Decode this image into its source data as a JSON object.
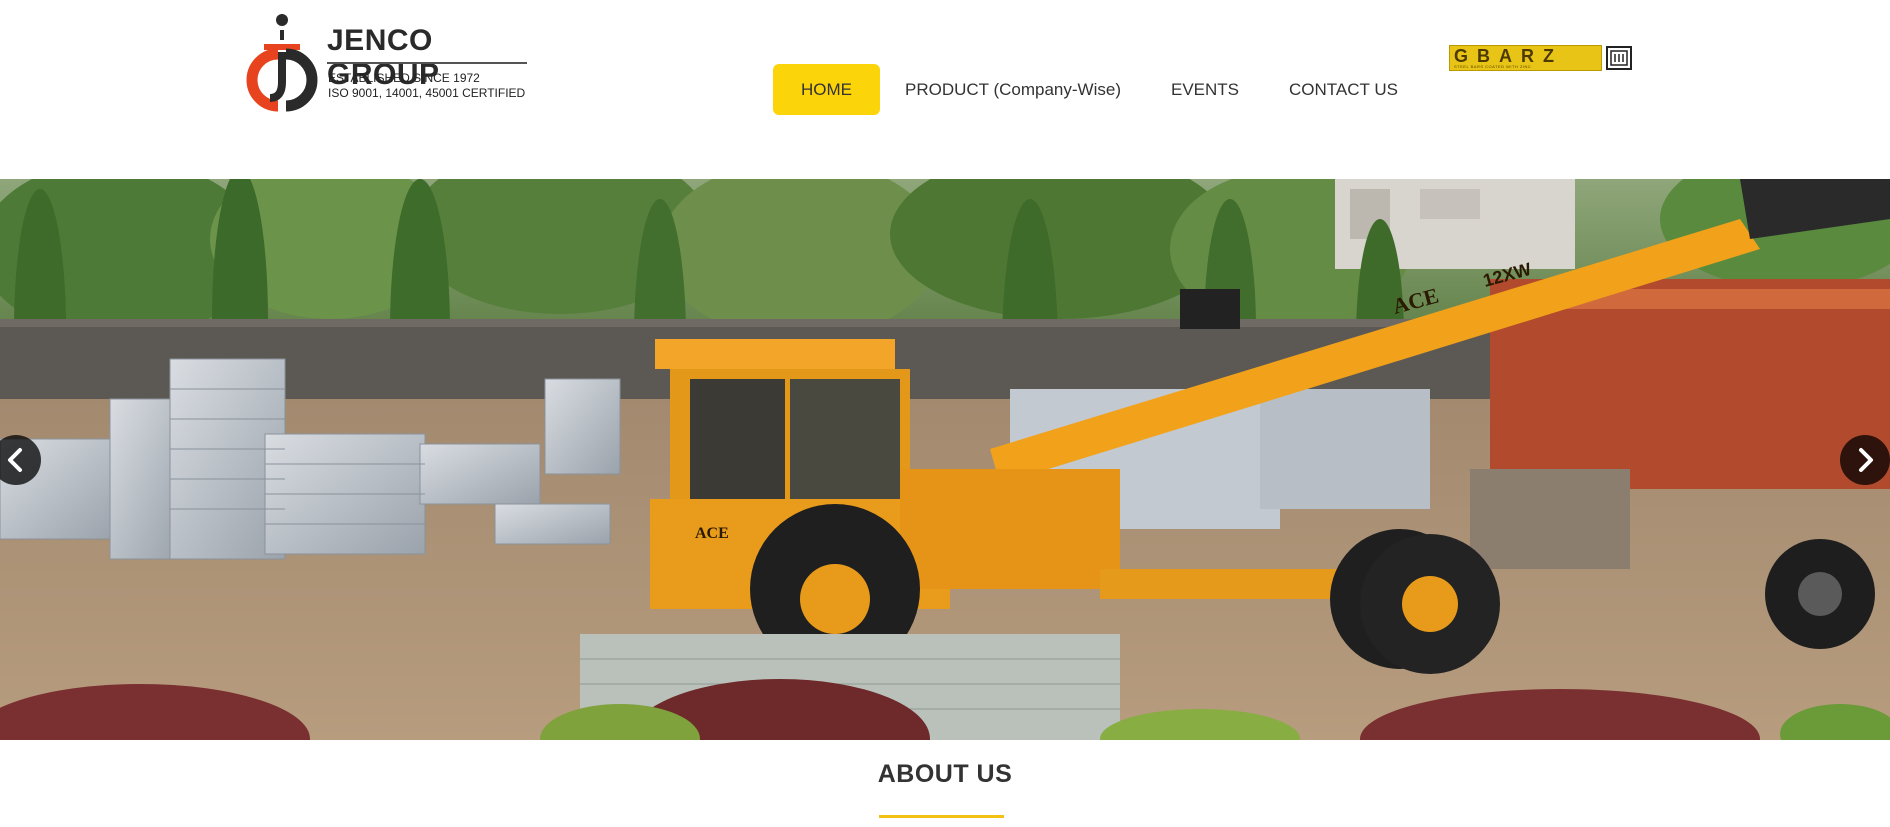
{
  "brand": {
    "name": "JENCO GROUP",
    "tagline": "ESTABLISHED SINCE 1972",
    "certification": "ISO 9001, 14001, 45001 CERTIFIED",
    "colors": {
      "orange": "#e8431f",
      "dark": "#2a2a2a"
    }
  },
  "nav": {
    "items": [
      {
        "label": "HOME",
        "active": true
      },
      {
        "label": "PRODUCT (Company-Wise)",
        "active": false
      },
      {
        "label": "EVENTS",
        "active": false
      },
      {
        "label": "CONTACT US",
        "active": false
      }
    ],
    "active_color": "#fcd40a"
  },
  "partner_badge": {
    "text": "GBARZ",
    "subtext": "STEEL BARS COATED WITH ZINC",
    "mark": "ISI"
  },
  "hero": {
    "prev_icon": "chevron-left-icon",
    "next_icon": "chevron-right-icon",
    "crane_labels": {
      "brand": "ACE",
      "model": "12XW"
    }
  },
  "about": {
    "heading": "ABOUT US",
    "accent_color": "#f2c111"
  }
}
